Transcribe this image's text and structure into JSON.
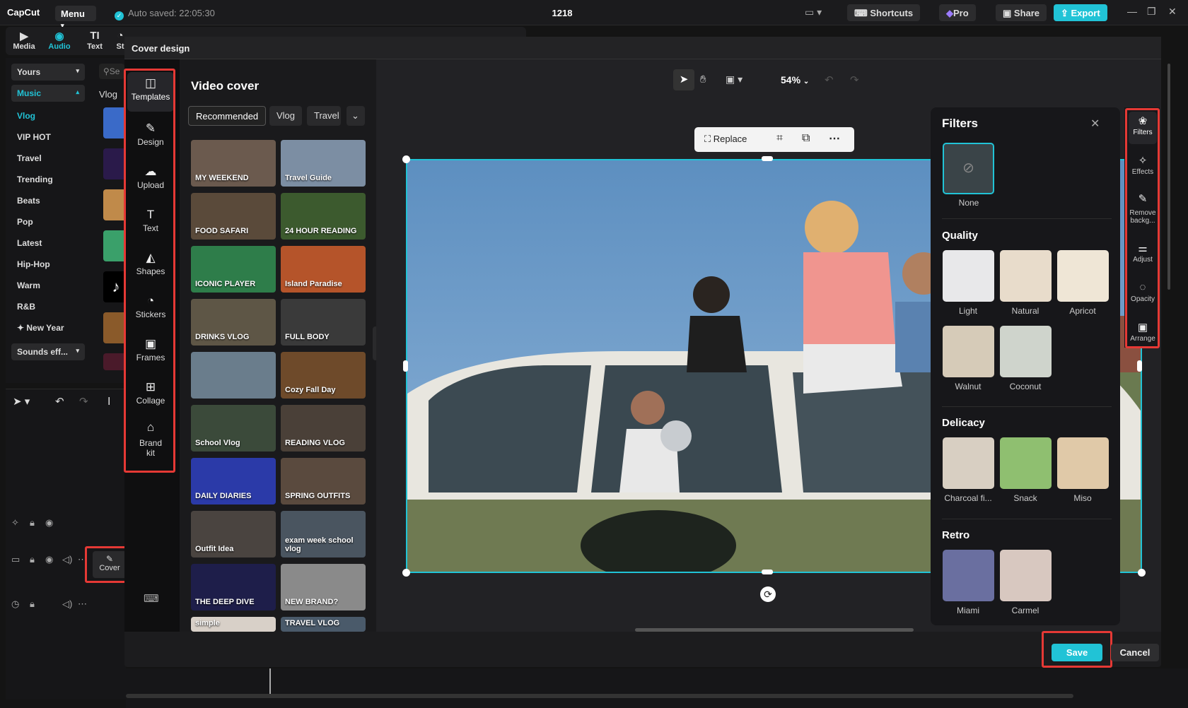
{
  "app": {
    "logo": "CapCut",
    "menu_label": "Menu",
    "autosave": "Auto saved: 22:05:30",
    "project_title": "1218",
    "shortcuts_label": "Shortcuts",
    "pro_label": "Pro",
    "share_label": "Share",
    "export_label": "Export"
  },
  "main_tools": [
    {
      "label": "Media",
      "icon": "media-icon"
    },
    {
      "label": "Audio",
      "icon": "audio-icon"
    },
    {
      "label": "Text",
      "icon": "text-icon"
    },
    {
      "label": "St",
      "icon": "stickers-icon"
    }
  ],
  "library": {
    "yours_label": "Yours",
    "music_label": "Music",
    "items": [
      "Vlog",
      "VIP HOT",
      "Travel",
      "Trending",
      "Beats",
      "Pop",
      "Latest",
      "Hip-Hop",
      "Warm",
      "R&B",
      "New Year"
    ],
    "sounds_label": "Sounds eff...",
    "search_placeholder": "Se",
    "tab_vlog": "Vlog"
  },
  "timeline": {
    "cover_label": "Cover"
  },
  "modal": {
    "title": "Cover design",
    "sidebar": [
      {
        "label": "Templates",
        "icon": "templates-icon"
      },
      {
        "label": "Design",
        "icon": "design-icon"
      },
      {
        "label": "Upload",
        "icon": "upload-icon"
      },
      {
        "label": "Text",
        "icon": "text-icon"
      },
      {
        "label": "Shapes",
        "icon": "shapes-icon"
      },
      {
        "label": "Stickers",
        "icon": "stickers-icon"
      },
      {
        "label": "Frames",
        "icon": "frames-icon"
      },
      {
        "label": "Collage",
        "icon": "collage-icon"
      },
      {
        "label": "Brand\nkit",
        "icon": "brand-kit-icon"
      }
    ],
    "panel_title": "Video cover",
    "chips": [
      "Recommended",
      "Vlog",
      "Travel"
    ],
    "templates": [
      {
        "text": "MY WEEKEND",
        "color": "#6b5a4e"
      },
      {
        "text": "Travel Guide",
        "color": "#7c8ea3"
      },
      {
        "text": "FOOD SAFARI",
        "color": "#5a4a3a"
      },
      {
        "text": "24 HOUR READING",
        "color": "#3c5a2e"
      },
      {
        "text": "ICONIC PLAYER",
        "color": "#2e7d4a"
      },
      {
        "text": "Island Paradise",
        "color": "#b5542a"
      },
      {
        "text": "DRINKS VLOG",
        "color": "#5e5646"
      },
      {
        "text": "FULL BODY",
        "color": "#3a3a3a"
      },
      {
        "text": "",
        "color": "#6a7d8c"
      },
      {
        "text": "Cozy Fall Day",
        "color": "#6e4a2a"
      },
      {
        "text": "School Vlog",
        "color": "#3b4a3a"
      },
      {
        "text": "READING VLOG",
        "color": "#4a4038"
      },
      {
        "text": "DAILY DIARIES",
        "color": "#2b3aa8"
      },
      {
        "text": "SPRING OUTFITS",
        "color": "#5a4a3e"
      },
      {
        "text": "Outfit Idea",
        "color": "#4a4440"
      },
      {
        "text": "exam week school vlog",
        "color": "#4a5560"
      },
      {
        "text": "THE DEEP DIVE",
        "color": "#1e1e4a"
      },
      {
        "text": "NEW BRAND?",
        "color": "#8a8a8a"
      },
      {
        "text": "simple",
        "color": "#d8d0c8"
      },
      {
        "text": "TRAVEL VLOG",
        "color": "#4a5a6a"
      }
    ],
    "zoom": "54%",
    "float_bar": {
      "replace_label": "Replace"
    },
    "filters": {
      "title": "Filters",
      "none_label": "None",
      "sections": [
        {
          "name": "Quality",
          "items": [
            "Light",
            "Natural",
            "Apricot",
            "Walnut",
            "Coconut"
          ]
        },
        {
          "name": "Delicacy",
          "items": [
            "Charcoal fi...",
            "Snack",
            "Miso"
          ]
        },
        {
          "name": "Retro",
          "items": [
            "Miami",
            "Carmel"
          ]
        }
      ]
    },
    "right_tools": [
      {
        "label": "Filters",
        "icon": "filters-icon"
      },
      {
        "label": "Effects",
        "icon": "effects-icon"
      },
      {
        "label": "Remove backg...",
        "icon": "remove-background-icon"
      },
      {
        "label": "Adjust",
        "icon": "adjust-icon"
      },
      {
        "label": "Opacity",
        "icon": "opacity-icon"
      },
      {
        "label": "Arrange",
        "icon": "arrange-icon"
      }
    ],
    "save_label": "Save",
    "cancel_label": "Cancel"
  }
}
